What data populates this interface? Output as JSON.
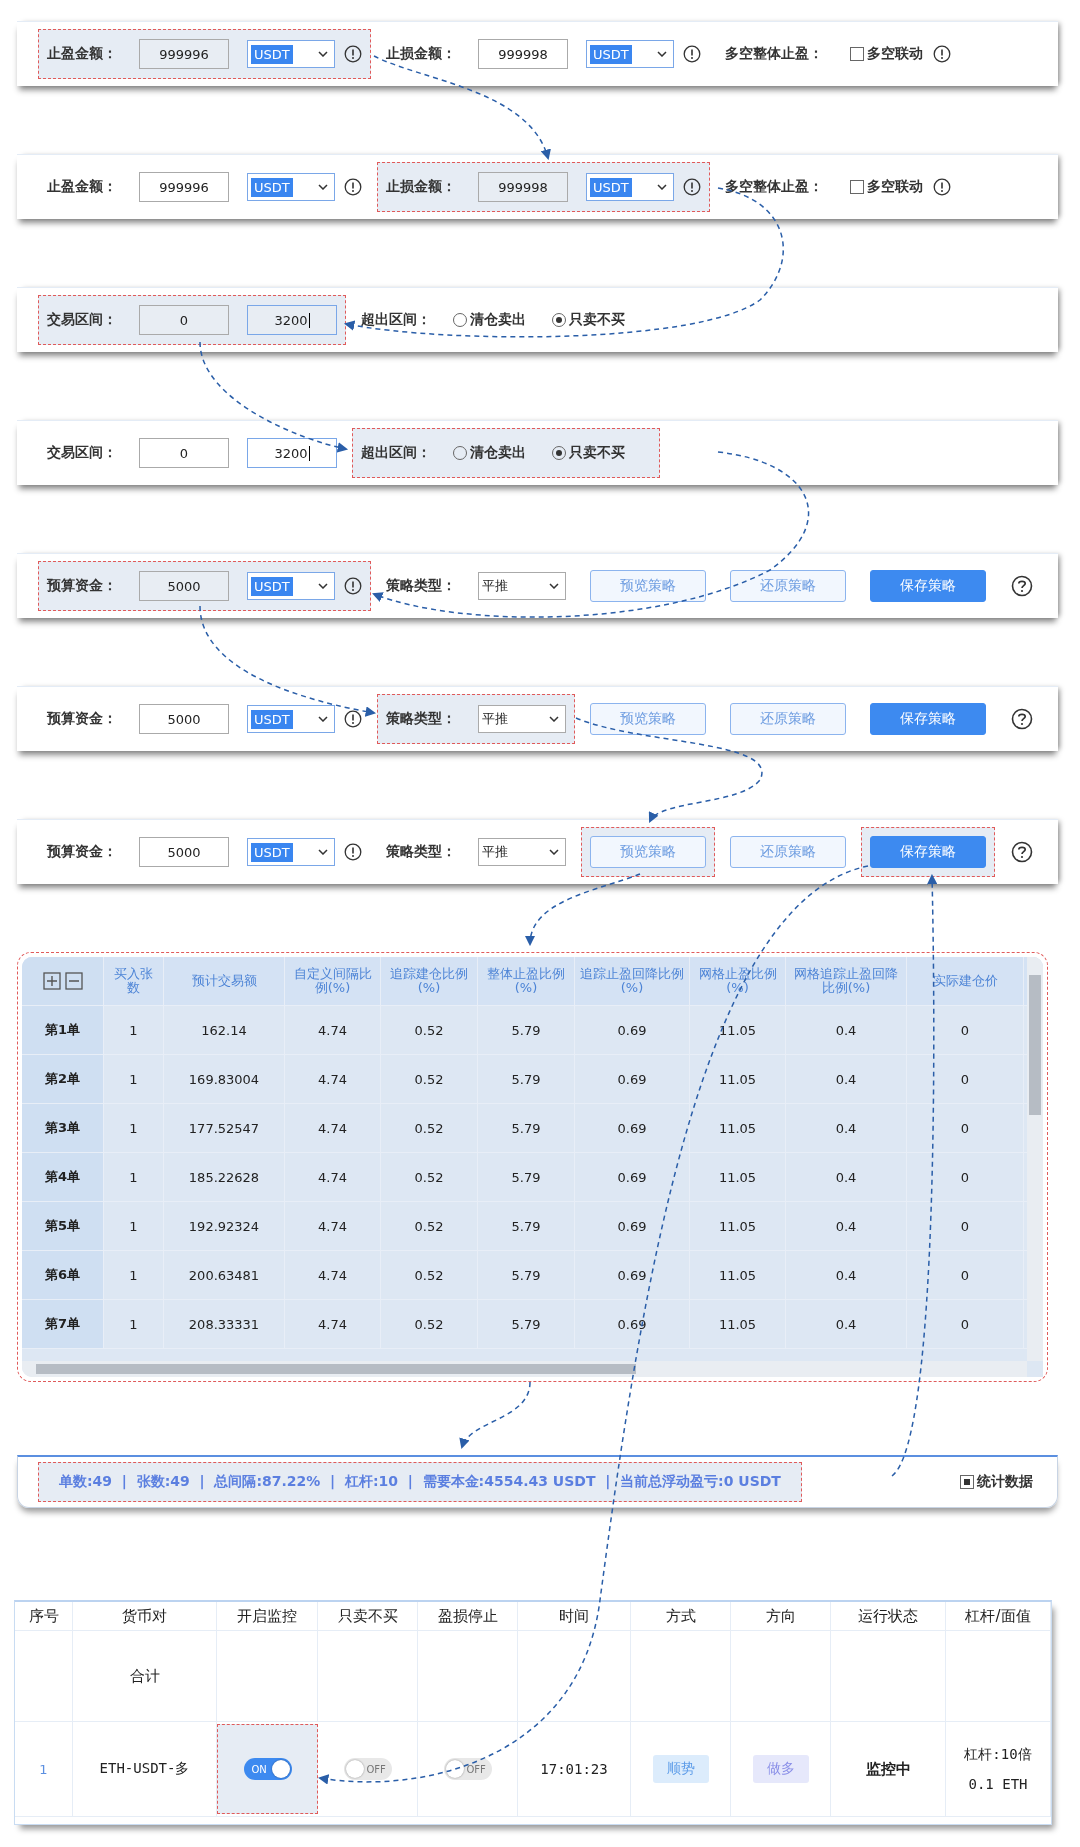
{
  "panels": [
    {
      "groups": [
        {
          "kind": "amount",
          "label": "止盈金额：",
          "value": "999996",
          "currency": "USDT",
          "highlighted": true
        },
        {
          "kind": "amount",
          "label": "止损金额：",
          "value": "999998",
          "currency": "USDT",
          "highlighted": false
        },
        {
          "kind": "checkbox",
          "label": "多空整体止盈：",
          "option": "多空联动",
          "checked": false,
          "highlighted": false
        }
      ]
    },
    {
      "groups": [
        {
          "kind": "amount",
          "label": "止盈金额：",
          "value": "999996",
          "currency": "USDT",
          "highlighted": false
        },
        {
          "kind": "amount",
          "label": "止损金额：",
          "value": "999998",
          "currency": "USDT",
          "highlighted": true
        },
        {
          "kind": "checkbox",
          "label": "多空整体止盈：",
          "option": "多空联动",
          "checked": false,
          "highlighted": false
        }
      ]
    },
    {
      "groups": [
        {
          "kind": "range",
          "label": "交易区间：",
          "from": "0",
          "to": "3200",
          "highlighted": true
        },
        {
          "kind": "radio",
          "label": "超出区间：",
          "options": [
            {
              "label": "清仓卖出",
              "selected": false
            },
            {
              "label": "只卖不买",
              "selected": true
            }
          ],
          "highlighted": false
        }
      ]
    },
    {
      "groups": [
        {
          "kind": "range",
          "label": "交易区间：",
          "from": "0",
          "to": "3200",
          "highlighted": false
        },
        {
          "kind": "radio",
          "label": "超出区间：",
          "options": [
            {
              "label": "清仓卖出",
              "selected": false
            },
            {
              "label": "只卖不买",
              "selected": true
            }
          ],
          "highlighted": true
        }
      ]
    },
    {
      "groups": [
        {
          "kind": "amount",
          "label": "预算资金：",
          "value": "5000",
          "currency": "USDT",
          "highlighted": true
        },
        {
          "kind": "select",
          "label": "策略类型：",
          "value": "平推",
          "highlighted": false
        },
        {
          "kind": "button",
          "label": "预览策略",
          "primary": false,
          "highlighted": false
        },
        {
          "kind": "button",
          "label": "还原策略",
          "primary": false,
          "highlighted": false
        },
        {
          "kind": "button",
          "label": "保存策略",
          "primary": true,
          "highlighted": false
        },
        {
          "kind": "help"
        }
      ]
    },
    {
      "groups": [
        {
          "kind": "amount",
          "label": "预算资金：",
          "value": "5000",
          "currency": "USDT",
          "highlighted": false
        },
        {
          "kind": "select",
          "label": "策略类型：",
          "value": "平推",
          "highlighted": true
        },
        {
          "kind": "button",
          "label": "预览策略",
          "primary": false,
          "highlighted": false
        },
        {
          "kind": "button",
          "label": "还原策略",
          "primary": false,
          "highlighted": false
        },
        {
          "kind": "button",
          "label": "保存策略",
          "primary": true,
          "highlighted": false
        },
        {
          "kind": "help"
        }
      ]
    },
    {
      "groups": [
        {
          "kind": "amount",
          "label": "预算资金：",
          "value": "5000",
          "currency": "USDT",
          "highlighted": false
        },
        {
          "kind": "select",
          "label": "策略类型：",
          "value": "平推",
          "highlighted": false
        },
        {
          "kind": "button",
          "label": "预览策略",
          "primary": false,
          "highlighted": true
        },
        {
          "kind": "button",
          "label": "还原策略",
          "primary": false,
          "highlighted": false
        },
        {
          "kind": "button",
          "label": "保存策略",
          "primary": true,
          "highlighted": true
        },
        {
          "kind": "help"
        }
      ]
    }
  ],
  "grid_table": {
    "highlighted": true,
    "columns": [
      "买入张数",
      "预计交易额",
      "自定义间隔比例(%)",
      "追踪建仓比例(%)",
      "整体止盈比例(%)",
      "追踪止盈回降比例(%)",
      "网格止盈比例(%)",
      "网格追踪止盈回降比例(%)",
      "实际建仓价"
    ],
    "rows": [
      {
        "label": "第1单",
        "cells": [
          "1",
          "162.14",
          "4.74",
          "0.52",
          "5.79",
          "0.69",
          "11.05",
          "0.4",
          "0"
        ]
      },
      {
        "label": "第2单",
        "cells": [
          "1",
          "169.83004",
          "4.74",
          "0.52",
          "5.79",
          "0.69",
          "11.05",
          "0.4",
          "0"
        ]
      },
      {
        "label": "第3单",
        "cells": [
          "1",
          "177.52547",
          "4.74",
          "0.52",
          "5.79",
          "0.69",
          "11.05",
          "0.4",
          "0"
        ]
      },
      {
        "label": "第4单",
        "cells": [
          "1",
          "185.22628",
          "4.74",
          "0.52",
          "5.79",
          "0.69",
          "11.05",
          "0.4",
          "0"
        ]
      },
      {
        "label": "第5单",
        "cells": [
          "1",
          "192.92324",
          "4.74",
          "0.52",
          "5.79",
          "0.69",
          "11.05",
          "0.4",
          "0"
        ]
      },
      {
        "label": "第6单",
        "cells": [
          "1",
          "200.63481",
          "4.74",
          "0.52",
          "5.79",
          "0.69",
          "11.05",
          "0.4",
          "0"
        ]
      },
      {
        "label": "第7单",
        "cells": [
          "1",
          "208.33331",
          "4.74",
          "0.52",
          "5.79",
          "0.69",
          "11.05",
          "0.4",
          "0"
        ]
      }
    ]
  },
  "summary": {
    "text": "单数:49  |  张数:49  |  总间隔:87.22%  |  杠杆:10  |  需要本金:4554.43 USDT  |  当前总浮动盈亏:0 USDT",
    "highlighted": true,
    "checkbox": {
      "label": "统计数据",
      "checked": true
    }
  },
  "orders_table": {
    "columns": [
      "序号",
      "货币对",
      "开启监控",
      "只卖不买",
      "盈损停止",
      "时间",
      "方式",
      "方向",
      "运行状态",
      "杠杆/面值"
    ],
    "rows": [
      {
        "kind": "total",
        "label": "合计"
      },
      {
        "kind": "order",
        "index": "1",
        "pair": "ETH-USDT-多",
        "toggles": [
          {
            "label": "ON",
            "on": true,
            "highlighted": true
          },
          {
            "label": "OFF",
            "on": false,
            "highlighted": false
          },
          {
            "label": "OFF",
            "on": false,
            "highlighted": false
          }
        ],
        "time": "17:01:23",
        "mode": {
          "label": "顺势",
          "color": "#dcecfc"
        },
        "direction": {
          "label": "做多",
          "color": "#e6e8fb"
        },
        "status": "监控中",
        "leverage": "杠杆:10倍",
        "face_value": "0.1 ETH"
      }
    ]
  }
}
